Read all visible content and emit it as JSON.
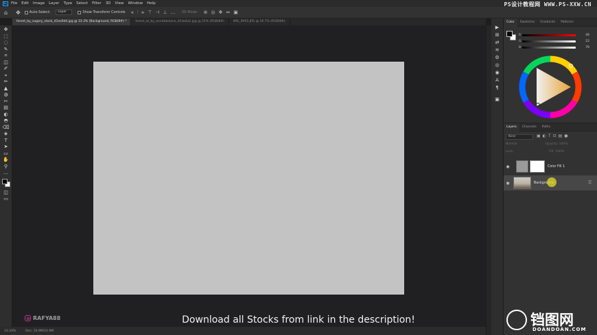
{
  "app": {
    "logo_text": "Ps",
    "menu": [
      "File",
      "Edit",
      "Image",
      "Layer",
      "Type",
      "Select",
      "Filter",
      "3D",
      "View",
      "Window",
      "Help"
    ],
    "watermark_top": "PS设计教程网 WWW.PS-XXW.CN"
  },
  "options": {
    "auto_select_label": "Auto-Select:",
    "auto_select_value": "Layer",
    "transform_label": "Show Transform Controls",
    "mode_3d": "3D Mode:"
  },
  "tabs": [
    {
      "label": "forest_by_sugary_stock_d1es0d4.jpg @ 33.3% (Background, RGB/8#) *",
      "active": true
    },
    {
      "label": "forest_at_by_annitabstock_d1da4a2.jpg @ 25% (RGB/8#)",
      "active": false
    },
    {
      "label": "IMG_9955.JPG @ 16.7% (RGB/8#)",
      "active": false
    }
  ],
  "tools": [
    "✥",
    "⬚",
    "◌",
    "✎",
    "⌗",
    "◫",
    "✐",
    "⌖",
    "✏",
    "▲",
    "◍",
    "✂",
    "▤",
    "◐",
    "◓",
    "⌫",
    "◈",
    "T",
    "➤",
    "▭",
    "✋",
    "⚲",
    "…"
  ],
  "canvas": {
    "bg_color": "#c3c3c3"
  },
  "caption": "Download all Stocks from link in the description!",
  "credit": "RAFYA88",
  "status": {
    "zoom": "33.33%",
    "doc": "Doc: 10.9M/10.9M"
  },
  "dock_icons": [
    "▶",
    "⊞",
    "⇄",
    "≋",
    "⚙",
    "◎",
    "◉",
    "A",
    "¶",
    "▣"
  ],
  "color_panel": {
    "tabs": [
      "Color",
      "Swatches",
      "Gradients",
      "Patterns"
    ],
    "sliders": [
      {
        "label": "R",
        "value": "46"
      },
      {
        "label": "G",
        "value": "22"
      },
      {
        "label": "B",
        "value": "76"
      }
    ]
  },
  "layers_panel": {
    "tabs": [
      "Layers",
      "Channels",
      "Paths"
    ],
    "filter_label": "Kind",
    "blend_mode": "Normal",
    "opacity": "Opacity: 100%",
    "lock": "Lock:",
    "fill": "Fill: 100%",
    "layers": [
      {
        "name": "Color Fill 1",
        "selected": false
      },
      {
        "name": "Background",
        "selected": true
      }
    ]
  },
  "logo_watermark": {
    "cn": "铛图网",
    "en": "DOANDOAN.COM"
  }
}
